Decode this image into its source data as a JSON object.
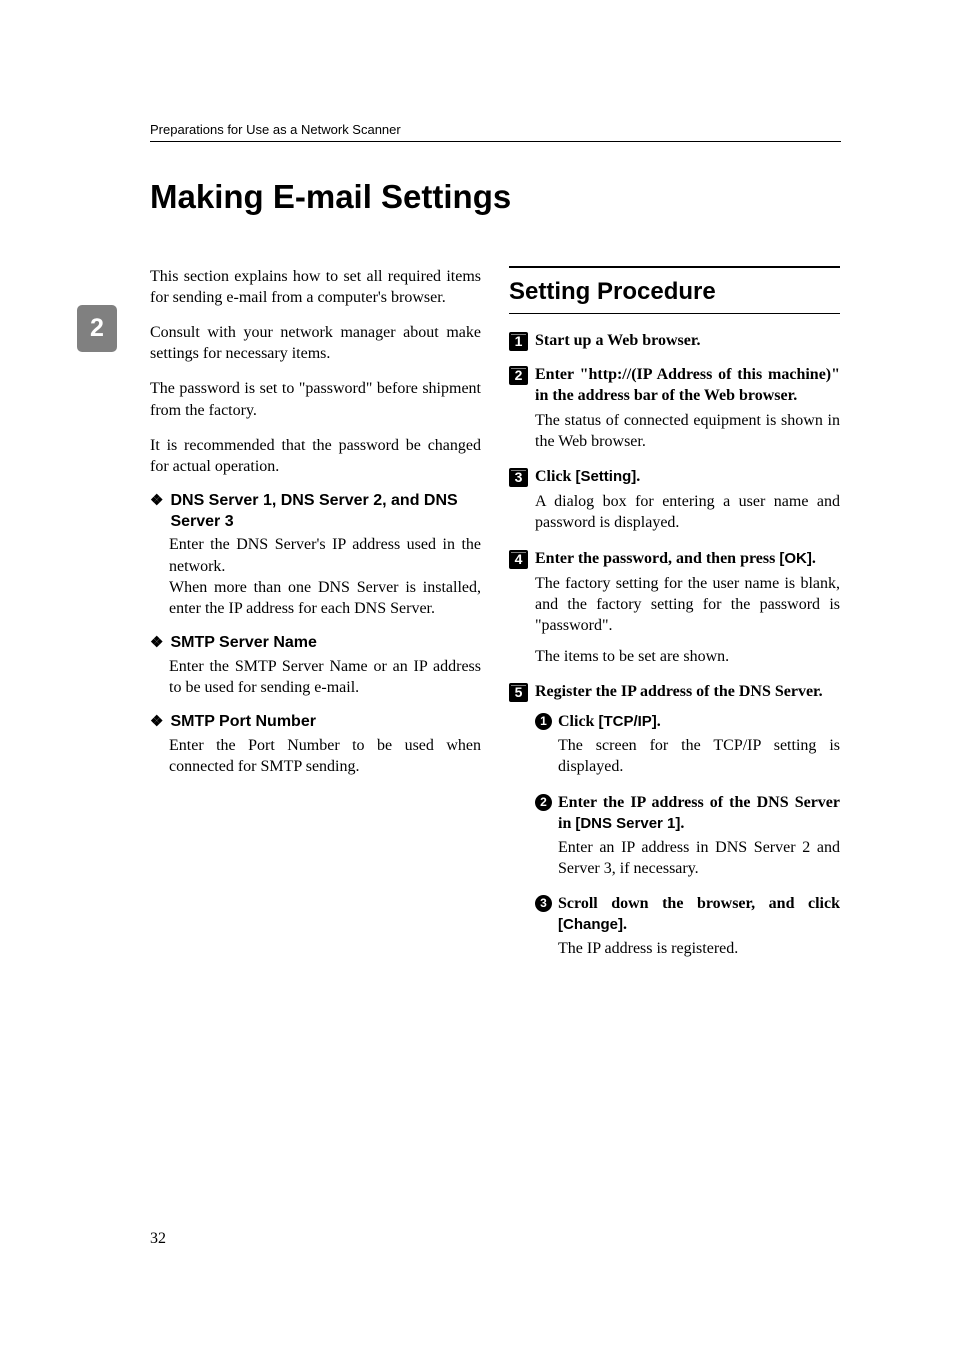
{
  "running_head": "Preparations for Use as a Network Scanner",
  "title": "Making E-mail Settings",
  "tab_number": "2",
  "left": {
    "p1": "This section explains how to set all required items for sending e-mail from a computer's browser.",
    "p2": "Consult with your network manager about make settings for necessary items.",
    "p3": "The password is set to \"password\" before shipment from the factory.",
    "p4": "It is recommended that the password be changed for actual operation.",
    "dia1_title": "DNS Server 1, DNS Server 2, and DNS Server 3",
    "dia1_body": "Enter the DNS Server's IP address used in the network.\nWhen more than one DNS Server is installed, enter the IP address for each DNS Server.",
    "dia2_title": "SMTP Server Name",
    "dia2_body": "Enter the SMTP Server Name or an IP address to be used for sending e-mail.",
    "dia3_title": "SMTP Port Number",
    "dia3_body": "Enter the Port Number to be used when connected for SMTP sending."
  },
  "right": {
    "h2": "Setting Procedure",
    "s1": "Start up a Web browser.",
    "s2": "Enter \"http://(IP Address of this machine)\" in the address bar of the Web browser.",
    "s2_body": "The status of connected equipment is shown in the Web browser.",
    "s3_pre": "Click ",
    "s3_ui": "[Setting]",
    "s3_post": ".",
    "s3_body": "A dialog box for entering a user name and password is displayed.",
    "s4_pre": "Enter the password, and then press ",
    "s4_ui": "[OK]",
    "s4_post": ".",
    "s4_body1": "The factory setting for the user name is blank, and the factory setting for the password is \"password\".",
    "s4_body2": "The items to be set are shown.",
    "s5": "Register the IP address of the DNS Server.",
    "s5a_pre": "Click ",
    "s5a_ui": "[TCP/IP]",
    "s5a_post": ".",
    "s5a_body": "The screen for the TCP/IP setting is displayed.",
    "s5b_pre": "Enter the IP address of the DNS Server in ",
    "s5b_ui": "[DNS Server 1]",
    "s5b_post": ".",
    "s5b_body": "Enter an IP address in DNS Server 2 and Server 3, if necessary.",
    "s5c_pre": "Scroll down the browser, and click ",
    "s5c_ui": "[Change]",
    "s5c_post": ".",
    "s5c_body": "The IP address is registered."
  },
  "page_number": "32"
}
